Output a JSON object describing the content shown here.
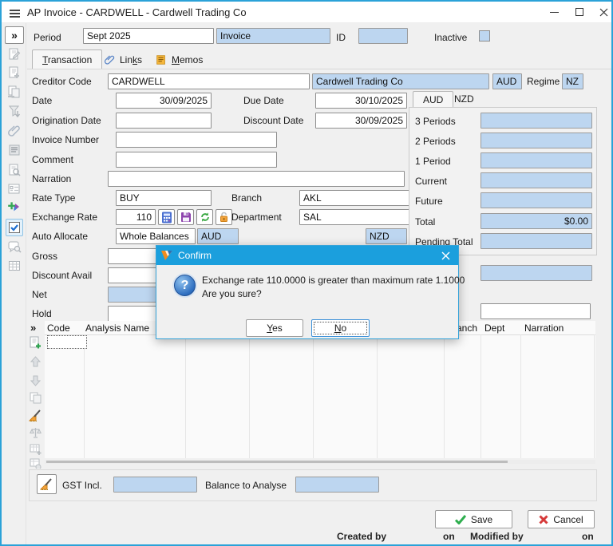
{
  "window": {
    "title": "AP Invoice - CARDWELL - Cardwell Trading Co"
  },
  "topbar": {
    "expand_glyph": "»",
    "period_label": "Period",
    "period_value": "Sept 2025",
    "type_value": "Invoice",
    "id_label": "ID",
    "inactive_label": "Inactive"
  },
  "tabs": {
    "transaction": "Transaction",
    "links": "Links",
    "memos": "Memos"
  },
  "form": {
    "creditor_code_label": "Creditor Code",
    "creditor_code": "CARDWELL",
    "creditor_name": "Cardwell Trading Co",
    "currency": "AUD",
    "regime_label": "Regime",
    "regime": "NZ",
    "date_label": "Date",
    "date": "30/09/2025",
    "due_date_label": "Due Date",
    "due_date": "30/10/2025",
    "origination_date_label": "Origination Date",
    "origination_date": "",
    "discount_date_label": "Discount Date",
    "discount_date": "30/09/2025",
    "invoice_number_label": "Invoice Number",
    "invoice_number": "",
    "comment_label": "Comment",
    "comment": "",
    "narration_label": "Narration",
    "narration": "",
    "rate_type_label": "Rate Type",
    "rate_type": "BUY",
    "branch_label": "Branch",
    "branch": "AKL",
    "exchange_rate_label": "Exchange Rate",
    "exchange_rate": "110",
    "department_label": "Department",
    "department": "SAL",
    "auto_allocate_label": "Auto Allocate",
    "auto_allocate": "Whole Balances",
    "aud_col_label": "AUD",
    "nzd_col_label": "NZD",
    "gross_label": "Gross",
    "discount_avail_label": "Discount Avail",
    "net_label": "Net",
    "hold_label": "Hold"
  },
  "periods": {
    "tab_aud": "AUD",
    "tab_nzd": "NZD",
    "rows": [
      "3 Periods",
      "2 Periods",
      "1 Period",
      "Current",
      "Future"
    ],
    "total_label": "Total",
    "total_value": "$0.00",
    "pending_label": "Pending Total"
  },
  "dialog": {
    "title": "Confirm",
    "message_line1": "Exchange rate 110.0000 is greater than maximum rate 1.1000",
    "message_line2": "Are you sure?",
    "yes_label": "Yes",
    "no_label": "No"
  },
  "grid": {
    "expand_glyph": "»",
    "columns": [
      "Code",
      "Analysis Name",
      "Branch",
      "Dept",
      "Narration"
    ]
  },
  "footer": {
    "gst_label": "GST Incl.",
    "balance_label": "Balance to Analyse"
  },
  "actions": {
    "save_label": "Save",
    "cancel_label": "Cancel"
  },
  "statusbar": {
    "created_label": "Created by",
    "created_on_label": "on",
    "modified_label": "Modified by",
    "modified_on_label": "on"
  },
  "colors": {
    "accent_blue": "#2ba2d8",
    "dialog_title_blue": "#1b9fdd",
    "field_blue": "#bdd6f0",
    "save_green": "#2eae4e",
    "cancel_red": "#d63a3a",
    "warn_orange": "#f2a33c",
    "icon_purple": "#8e44ad",
    "refresh_green": "#3aa843"
  }
}
